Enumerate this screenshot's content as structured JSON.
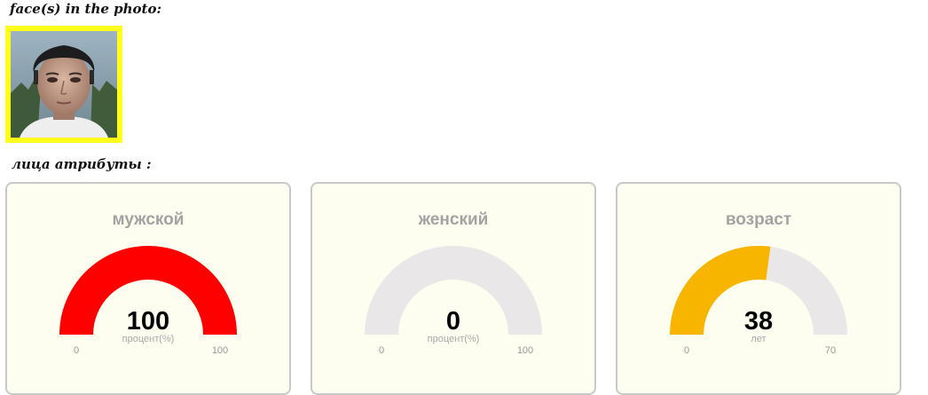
{
  "faces_section": {
    "title": "face(s) in the photo:",
    "frame_color": "#ffff1c",
    "faces": [
      {
        "thumbnail": "face-photo"
      }
    ]
  },
  "attributes_section": {
    "title": "лица атрибуты :"
  },
  "gauges": [
    {
      "title": "мужской",
      "value": 100,
      "min": 0,
      "max": 100,
      "unit": "процент(%)",
      "min_label": "0",
      "max_label": "100",
      "value_label": "100",
      "color": "#ff0000"
    },
    {
      "title": "женский",
      "value": 0,
      "min": 0,
      "max": 100,
      "unit": "процент(%)",
      "min_label": "0",
      "max_label": "100",
      "value_label": "0",
      "color": "#ff0000"
    },
    {
      "title": "возраст",
      "value": 38,
      "min": 0,
      "max": 70,
      "unit": "лет",
      "min_label": "0",
      "max_label": "70",
      "value_label": "38",
      "color": "#f7b500"
    }
  ],
  "colors": {
    "gauge_track": "#e9e7e7",
    "card_background": "#fdfdf0",
    "card_border": "#c8c8c8",
    "title_text": "#a3a3a3"
  }
}
